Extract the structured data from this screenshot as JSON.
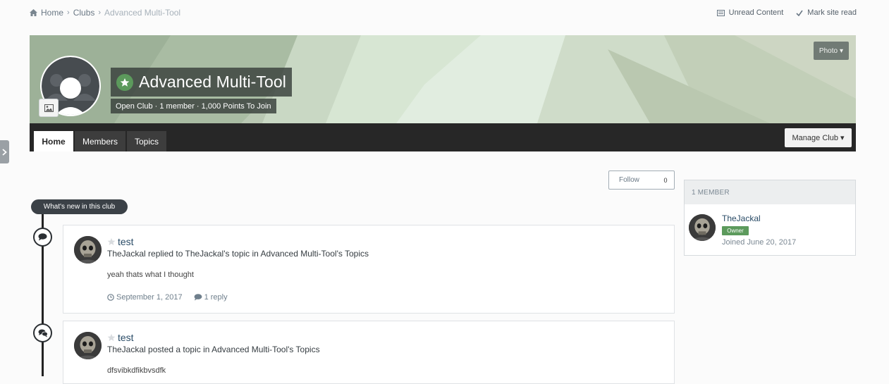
{
  "breadcrumb": {
    "home": "Home",
    "clubs": "Clubs",
    "current": "Advanced Multi-Tool"
  },
  "top_links": {
    "unread": "Unread Content",
    "mark_read": "Mark site read"
  },
  "banner": {
    "photo_label": "Photo"
  },
  "club": {
    "name": "Advanced Multi-Tool",
    "subtitle": "Open Club · 1 member · 1,000 Points To Join"
  },
  "tabs": [
    {
      "label": "Home"
    },
    {
      "label": "Members"
    },
    {
      "label": "Topics"
    }
  ],
  "manage_label": "Manage Club",
  "follow": {
    "label": "Follow",
    "count": "0"
  },
  "feed": {
    "header": "What's new in this club",
    "items": [
      {
        "title": "test",
        "desc": "TheJackal replied to TheJackal's topic in Advanced Multi-Tool's Topics",
        "body": "yeah thats what I thought",
        "date": "September 1, 2017",
        "replies": "1 reply"
      },
      {
        "title": "test",
        "desc": "TheJackal posted a topic in Advanced Multi-Tool's Topics",
        "body": "dfsvibkdfikbvsdfk"
      }
    ]
  },
  "members": {
    "header": "1 MEMBER",
    "name": "TheJackal",
    "role": "Owner",
    "joined": "Joined June 20, 2017"
  },
  "colors": {
    "accent_green": "#5c9a5c",
    "nav_dark": "#272727",
    "link_blue": "#294b66"
  },
  "icons": [
    "home-icon",
    "chevron-right-icon",
    "unread-icon",
    "check-icon",
    "caret-down-icon",
    "star-icon",
    "image-icon",
    "comment-icon",
    "comments-icon",
    "clock-icon"
  ]
}
